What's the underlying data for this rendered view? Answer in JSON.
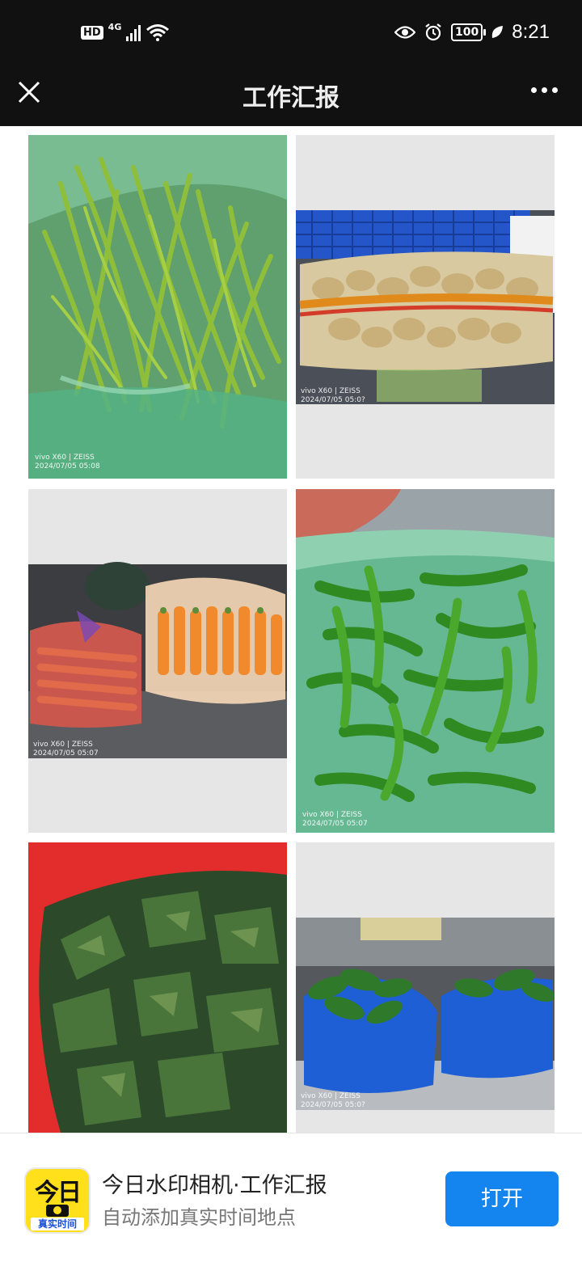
{
  "status_bar": {
    "hd_label": "HD",
    "network_label": "4G",
    "battery_level": "100",
    "time": "8:21"
  },
  "header": {
    "title": "工作汇报"
  },
  "photos": [
    {
      "alt_subject": "green-beans",
      "watermark_device": "vivo X60 | ZEISS",
      "watermark_date": "2024/07/05 05:08"
    },
    {
      "alt_subject": "potatoes",
      "watermark_device": "vivo X60 | ZEISS",
      "watermark_date": "2024/07/05 05:0?"
    },
    {
      "alt_subject": "carrots",
      "watermark_device": "vivo X60 | ZEISS",
      "watermark_date": "2024/07/05 05:07"
    },
    {
      "alt_subject": "green-peppers",
      "watermark_device": "vivo X60 | ZEISS",
      "watermark_date": "2024/07/05 05:07"
    },
    {
      "alt_subject": "kelp",
      "watermark_device": "",
      "watermark_date": ""
    },
    {
      "alt_subject": "leafy-greens",
      "watermark_device": "vivo X60 | ZEISS",
      "watermark_date": "2024/07/05 05:0?"
    }
  ],
  "banner": {
    "app_icon_top": "今日",
    "app_icon_bottom": "真实时间",
    "app_name": "今日水印相机·工作汇报",
    "app_desc": "自动添加真实时间地点",
    "open_label": "打开"
  },
  "colors": {
    "accent": "#1485ee",
    "bar_bg": "#111111",
    "app_icon_yellow": "#ffe01b"
  }
}
